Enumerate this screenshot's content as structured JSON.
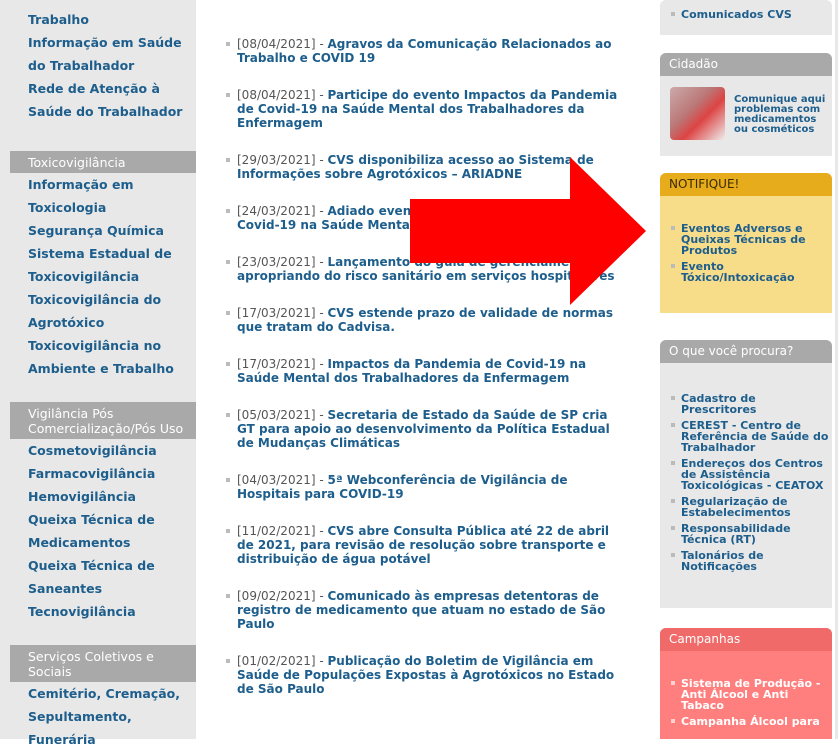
{
  "sidebar": {
    "top_items": [
      "Trabalho",
      "Informação em Saúde",
      "do Trabalhador",
      "Rede de Atenção à",
      "Saúde do Trabalhador"
    ],
    "toxico_head": "Toxicovigilância",
    "toxico_items": [
      "Informação em",
      "Toxicologia",
      "Segurança Química",
      "Sistema Estadual de",
      "Toxicovigilância",
      "Toxicovigilância do",
      "Agrotóxico",
      "Toxicovigilância no",
      "Ambiente e Trabalho"
    ],
    "pos_head": "Vigilância Pós Comercialização/Pós Uso",
    "pos_items": [
      "Cosmetovigilância",
      "Farmacovigilância",
      "Hemovigilância",
      "Queixa Técnica de",
      "Medicamentos",
      "Queixa Técnica de",
      "Saneantes",
      "Tecnovigilância"
    ],
    "serv_head": "Serviços Coletivos e Sociais",
    "serv_items": [
      "Cemitério, Cremação,",
      "Sepultamento, Funerária"
    ]
  },
  "news": [
    {
      "date": "[08/04/2021]",
      "sep": " - ",
      "title": "Agravos da Comunicação Relacionados ao Trabalho e COVID 19"
    },
    {
      "date": "[08/04/2021]",
      "sep": " - ",
      "title": "Participe do evento Impactos da Pandemia de Covid-19 na Saúde Mental dos Trabalhadores da Enfermagem"
    },
    {
      "date": "[29/03/2021]",
      "sep": " - ",
      "title": "CVS disponibiliza acesso ao Sistema de Informações sobre Agrotóxicos – ARIADNE"
    },
    {
      "date": "[24/03/2021]",
      "sep": " - ",
      "title": "Adiado evento Impactos da Pandemia de Covid-19 na Saúde Mental dos Trabalhadores"
    },
    {
      "date": "[23/03/2021]",
      "sep": " - ",
      "title": "Lançamento do guia de gerenciamento apropriando do risco sanitário em serviços hospitalares"
    },
    {
      "date": "[17/03/2021]",
      "sep": " - ",
      "title": "CVS estende prazo de validade de normas que tratam do Cadvisa."
    },
    {
      "date": "[17/03/2021]",
      "sep": " - ",
      "title": "Impactos da Pandemia de Covid-19 na Saúde Mental dos Trabalhadores da Enfermagem"
    },
    {
      "date": "[05/03/2021]",
      "sep": " - ",
      "title": "Secretaria de Estado da Saúde de SP cria GT para apoio ao desenvolvimento da Política Estadual de Mudanças Climáticas"
    },
    {
      "date": "[04/03/2021]",
      "sep": " - ",
      "title": "5ª Webconferência de Vigilância de Hospitais para COVID-19"
    },
    {
      "date": "[11/02/2021]",
      "sep": " - ",
      "title": "CVS abre Consulta Pública até 22 de abril de 2021, para revisão de resolução sobre transporte e distribuição de água potável"
    },
    {
      "date": "[09/02/2021]",
      "sep": " - ",
      "title": "Comunicado às empresas detentoras de registro de medicamento que atuam no estado de São Paulo"
    },
    {
      "date": "[01/02/2021]",
      "sep": " - ",
      "title": "Publicação do Boletim de Vigilância em Saúde de Populações Expostas à Agrotóxicos no Estado de São Paulo"
    }
  ],
  "right": {
    "top_link": "Comunicados CVS",
    "cidadao_head": "Cidadão",
    "cidadao_text": "Comunique aqui problemas com medicamentos ou cosméticos",
    "notifique_head": "NOTIFIQUE!",
    "notifique_links": [
      "Eventos Adversos e Queixas Técnicas de Produtos",
      "Evento Tóxico/Intoxicação"
    ],
    "procura_head": "O que você procura?",
    "procura_links": [
      "Cadastro de Prescritores",
      "CEREST - Centro de Referência de Saúde do Trabalhador",
      "Endereços dos Centros de Assistência Toxicológicas - CEATOX",
      "Regularização de Estabelecimentos",
      "Responsabilidade Técnica (RT)",
      "Talonários de Notificações"
    ],
    "campanhas_head": "Campanhas",
    "campanhas_links": [
      "Sistema de Produção - Anti Álcool e Anti Tabaco",
      "Campanha Álcool para"
    ]
  },
  "colors": {
    "accent_red": "#ff0000",
    "link_blue": "#1d5e8c",
    "notify_yellow": "#e7ac1c",
    "campaign_red": "#ff7f7f"
  }
}
